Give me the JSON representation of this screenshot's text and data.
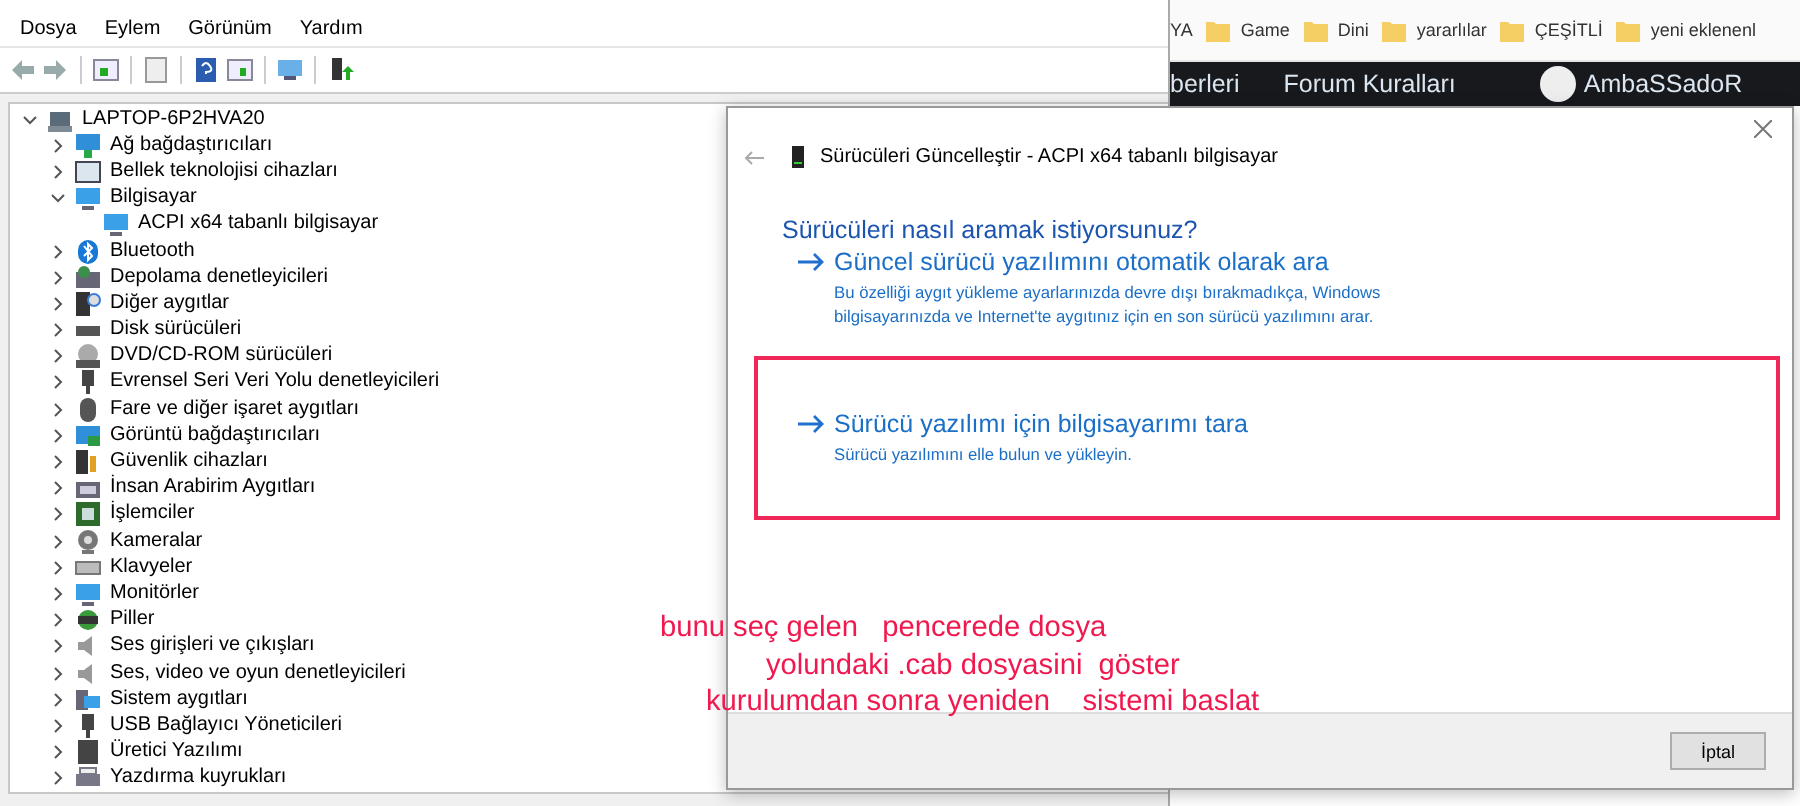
{
  "device_manager": {
    "menu": [
      "Dosya",
      "Eylem",
      "Görünüm",
      "Yardım"
    ],
    "tree": {
      "label": "LAPTOP-6P2HVA20",
      "kind": "computer",
      "expanded": true,
      "children": [
        {
          "label": "Ağ bağdaştırıcıları",
          "kind": "network",
          "expanded": false
        },
        {
          "label": "Bellek teknolojisi cihazları",
          "kind": "memory",
          "expanded": false
        },
        {
          "label": "Bilgisayar",
          "kind": "monitor",
          "expanded": true,
          "children": [
            {
              "label": "ACPI x64 tabanlı bilgisayar",
              "kind": "monitor"
            }
          ]
        },
        {
          "label": "Bluetooth",
          "kind": "bluetooth",
          "expanded": false
        },
        {
          "label": "Depolama denetleyicileri",
          "kind": "storage",
          "expanded": false
        },
        {
          "label": "Diğer aygıtlar",
          "kind": "other",
          "expanded": false
        },
        {
          "label": "Disk sürücüleri",
          "kind": "disk",
          "expanded": false
        },
        {
          "label": "DVD/CD-ROM sürücüleri",
          "kind": "dvd",
          "expanded": false
        },
        {
          "label": "Evrensel Seri Veri Yolu denetleyicileri",
          "kind": "usb",
          "expanded": false
        },
        {
          "label": "Fare ve diğer işaret aygıtları",
          "kind": "mouse",
          "expanded": false
        },
        {
          "label": "Görüntü bağdaştırıcıları",
          "kind": "display",
          "expanded": false
        },
        {
          "label": "Güvenlik cihazları",
          "kind": "security",
          "expanded": false
        },
        {
          "label": "İnsan Arabirim Aygıtları",
          "kind": "hid",
          "expanded": false
        },
        {
          "label": "İşlemciler",
          "kind": "cpu",
          "expanded": false
        },
        {
          "label": "Kameralar",
          "kind": "camera",
          "expanded": false
        },
        {
          "label": "Klavyeler",
          "kind": "keyboard",
          "expanded": false
        },
        {
          "label": "Monitörler",
          "kind": "monitor",
          "expanded": false
        },
        {
          "label": "Piller",
          "kind": "battery",
          "expanded": false
        },
        {
          "label": "Ses girişleri ve çıkışları",
          "kind": "audio",
          "expanded": false
        },
        {
          "label": "Ses, video ve oyun denetleyicileri",
          "kind": "audio",
          "expanded": false
        },
        {
          "label": "Sistem aygıtları",
          "kind": "system",
          "expanded": false
        },
        {
          "label": "USB Bağlayıcı Yöneticileri",
          "kind": "usb",
          "expanded": false
        },
        {
          "label": "Üretici Yazılımı",
          "kind": "firmware",
          "expanded": false
        },
        {
          "label": "Yazdırma kuyrukları",
          "kind": "printer",
          "expanded": false
        }
      ]
    }
  },
  "browser": {
    "bookmarks": [
      {
        "label": "YA",
        "kind": "text"
      },
      {
        "label": "Game",
        "kind": "folder"
      },
      {
        "label": "Dini",
        "kind": "folder"
      },
      {
        "label": "yararlılar",
        "kind": "folder"
      },
      {
        "label": "ÇEŞİTLİ",
        "kind": "folder"
      },
      {
        "label": "yeni eklenenl",
        "kind": "folder"
      }
    ],
    "nav": [
      {
        "label": "berleri",
        "kind": "link"
      },
      {
        "label": "Forum Kuralları",
        "kind": "link"
      },
      {
        "label": "AmbaSSadoR",
        "kind": "user"
      }
    ]
  },
  "dialog": {
    "title": "Sürücüleri Güncelleştir - ACPI x64 tabanlı bilgisayar",
    "heading": "Sürücüleri nasıl aramak istiyorsunuz?",
    "options": [
      {
        "title": "Güncel sürücü yazılımını otomatik olarak ara",
        "description": "Bu özelliği aygıt yükleme ayarlarınızda devre dışı bırakmadıkça, Windows\nbilgisayarınızda ve Internet'te aygıtınız için en son sürücü yazılımını arar.",
        "highlighted": false
      },
      {
        "title": "Sürücü yazılımı için bilgisayarımı tara",
        "description": "Sürücü yazılımını elle bulun ve yükleyin.",
        "highlighted": true
      }
    ],
    "cancel": "İptal"
  },
  "annotation": [
    "bunu seç gelen   pencerede dosya",
    "yolundaki .cab dosyasini  göster",
    "kurulumdan sonra yeniden    sistemi baslat"
  ]
}
